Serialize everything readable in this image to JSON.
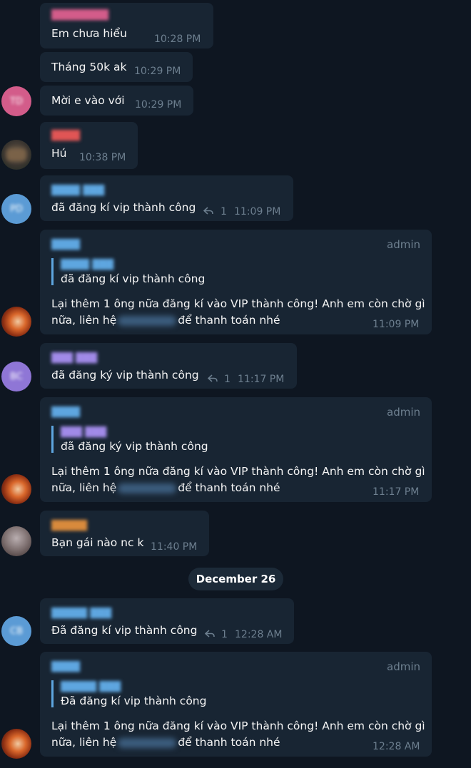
{
  "messages": [
    {
      "text": "Em chưa hiểu",
      "time": "10:28 PM"
    },
    {
      "text": "Tháng 50k ak",
      "time": "10:29 PM"
    },
    {
      "text": "Mời e vào với",
      "time": "10:29 PM"
    },
    {
      "text": "Hú",
      "time": "10:38 PM"
    },
    {
      "text": "đã đăng kí vip thành công",
      "time": "11:09 PM",
      "replies": "1"
    },
    {
      "role": "admin",
      "reply_text": "đã đăng kí vip thành công",
      "line1": "Lại thêm 1 ông nữa đăng kí vào VIP thành công! Anh em còn chờ gì",
      "line2_a": "nữa, liên hệ",
      "line2_b": "để thanh toán nhé",
      "time": "11:09 PM"
    },
    {
      "text": "đã đăng ký vip thành công",
      "time": "11:17 PM",
      "replies": "1"
    },
    {
      "role": "admin",
      "reply_text": "đã đăng ký vip thành công",
      "line1": "Lại thêm 1 ông nữa đăng kí vào VIP thành công! Anh em còn chờ gì",
      "line2_a": "nữa, liên hệ",
      "line2_b": "để thanh toán nhé",
      "time": "11:17 PM"
    },
    {
      "text": "Bạn gái nào nc k",
      "time": "11:40 PM"
    },
    {
      "text": "Đã đăng kí vip thành công",
      "time": "12:28 AM",
      "replies": "1"
    },
    {
      "role": "admin",
      "reply_text": "Đã đăng kí vip thành công",
      "line1": "Lại thêm 1 ông nữa đăng kí vào VIP thành công! Anh em còn chờ gì",
      "line2_a": "nữa, liên hệ",
      "line2_b": "để thanh toán nhé",
      "time": "12:28 AM"
    }
  ],
  "date_separator": "December 26",
  "colors": {
    "background": "#0e1621",
    "bubble": "#182533",
    "accent": "#5ea6e0",
    "meta": "#6d7f8f"
  }
}
